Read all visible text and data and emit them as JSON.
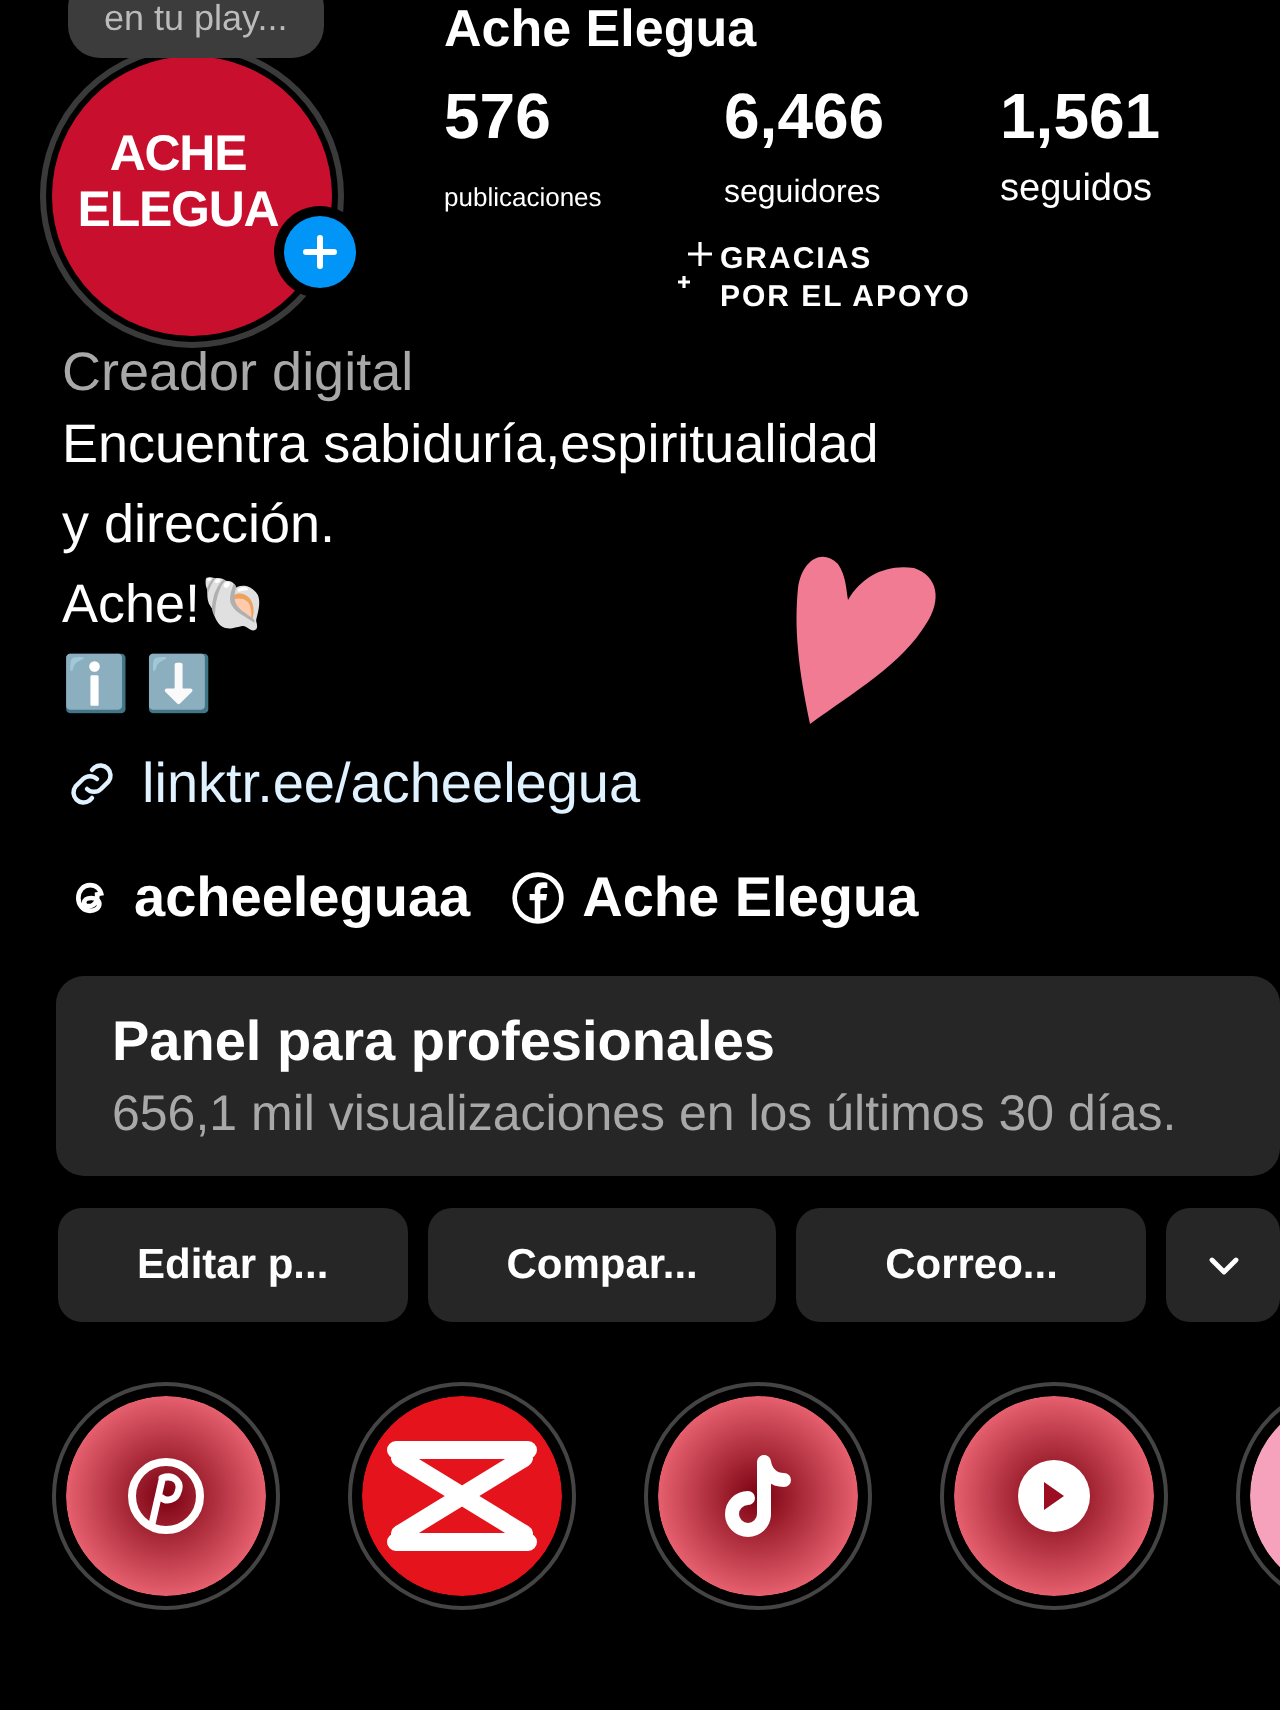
{
  "profile": {
    "name": "Ache Elegua",
    "note_bubble": "en tu play...",
    "avatar_logo": [
      "ACHE",
      "ELEGUA"
    ],
    "add_story": true
  },
  "stats": [
    {
      "value": "576",
      "label": "publicaciones"
    },
    {
      "value": "6,466",
      "label": "seguidores"
    },
    {
      "value": "1,561",
      "label": "seguidos"
    }
  ],
  "sticker_text": [
    "GRACIAS",
    "POR EL APOYO"
  ],
  "bio": {
    "category": "Creador digital",
    "lines": [
      "Encuentra sabiduría,espiritualidad",
      "y dirección.",
      "Ache!🐚",
      "ℹ️ ⬇️"
    ],
    "link": "linktr.ee/acheelegua"
  },
  "social_links": [
    {
      "kind": "threads",
      "label": "acheeleguaa"
    },
    {
      "kind": "facebook",
      "label": "Ache Elegua"
    }
  ],
  "dashboard": {
    "title": "Panel para profesionales",
    "subtitle": "656,1 mil visualizaciones en los últimos 30 días."
  },
  "buttons": [
    "Editar p...",
    "Compar...",
    "Correo..."
  ],
  "highlights": [
    {
      "kind": "pinterest"
    },
    {
      "kind": "capcut"
    },
    {
      "kind": "tiktok"
    },
    {
      "kind": "youtube"
    },
    {
      "kind": "partial"
    }
  ]
}
